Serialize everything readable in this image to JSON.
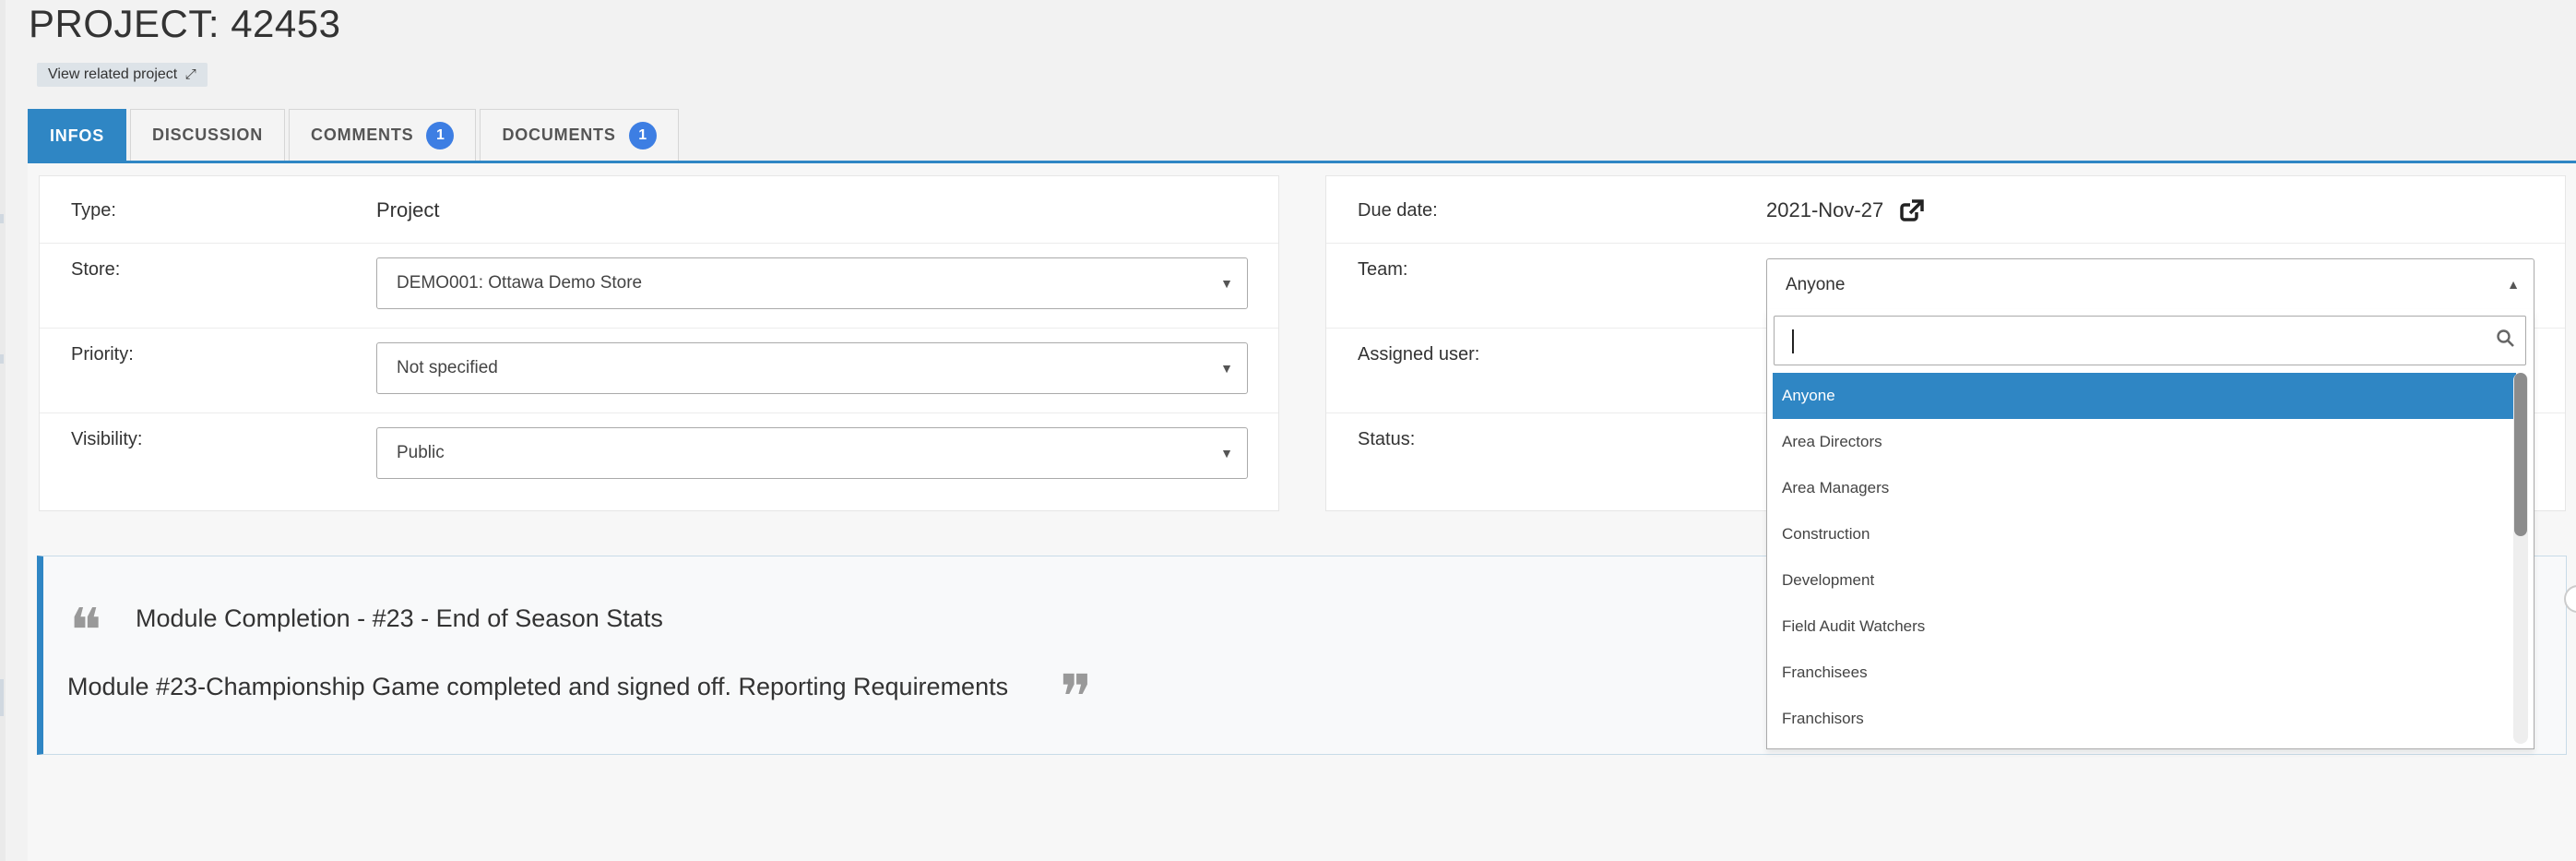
{
  "page": {
    "title": "PROJECT: 42453",
    "related_button": "View related project",
    "related_icon": "expand-arrows-icon"
  },
  "tabs": [
    {
      "label": "INFOS",
      "active": true
    },
    {
      "label": "DISCUSSION"
    },
    {
      "label": "COMMENTS",
      "badge": "1"
    },
    {
      "label": "DOCUMENTS",
      "badge": "1"
    }
  ],
  "left_panel": {
    "type_label": "Type:",
    "type_value": "Project",
    "store_label": "Store:",
    "store_value": "DEMO001: Ottawa Demo Store",
    "priority_label": "Priority:",
    "priority_value": "Not specified",
    "visibility_label": "Visibility:",
    "visibility_value": "Public"
  },
  "right_panel": {
    "due_label": "Due date:",
    "due_value": "2021-Nov-27",
    "team_label": "Team:",
    "team_value": "Anyone",
    "assigned_label": "Assigned user:",
    "status_label": "Status:"
  },
  "team_dropdown": {
    "search_value": "",
    "options": [
      "Anyone",
      "Area Directors",
      "Area Managers",
      "Construction",
      "Development",
      "Field Audit Watchers",
      "Franchisees",
      "Franchisors"
    ],
    "selected": "Anyone"
  },
  "quote": {
    "title": "Module Completion - #23 - End of Season Stats",
    "text": "Module #23-Championship Game completed and signed off. Reporting Requirements"
  },
  "colors": {
    "accent": "#2f86c4",
    "badge": "#3d7ee3"
  }
}
